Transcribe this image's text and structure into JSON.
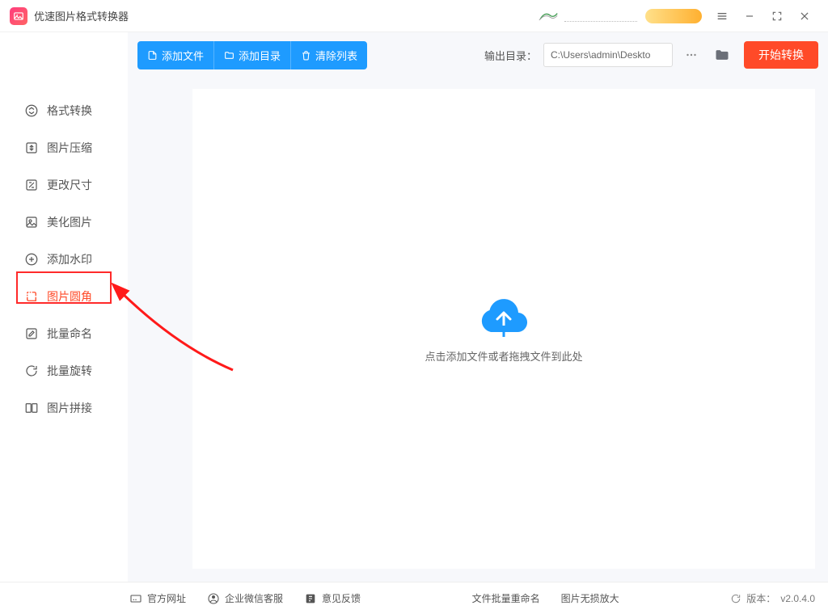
{
  "titlebar": {
    "title": "优速图片格式转换器"
  },
  "sidebar": {
    "items": [
      {
        "label": "格式转换"
      },
      {
        "label": "图片压缩"
      },
      {
        "label": "更改尺寸"
      },
      {
        "label": "美化图片"
      },
      {
        "label": "添加水印"
      },
      {
        "label": "图片圆角"
      },
      {
        "label": "批量命名"
      },
      {
        "label": "批量旋转"
      },
      {
        "label": "图片拼接"
      }
    ],
    "active_index": 5
  },
  "toolbar": {
    "add_file": "添加文件",
    "add_folder": "添加目录",
    "clear_list": "清除列表",
    "output_label": "输出目录：",
    "output_path": "C:\\Users\\admin\\Deskto",
    "start": "开始转换"
  },
  "canvas": {
    "hint": "点击添加文件或者拖拽文件到此处"
  },
  "footer": {
    "official_site": "官方网址",
    "wechat_support": "企业微信客服",
    "feedback": "意见反馈",
    "batch_rename": "文件批量重命名",
    "lossless_zoom": "图片无损放大",
    "version_label": "版本：",
    "version": "v2.0.4.0"
  }
}
